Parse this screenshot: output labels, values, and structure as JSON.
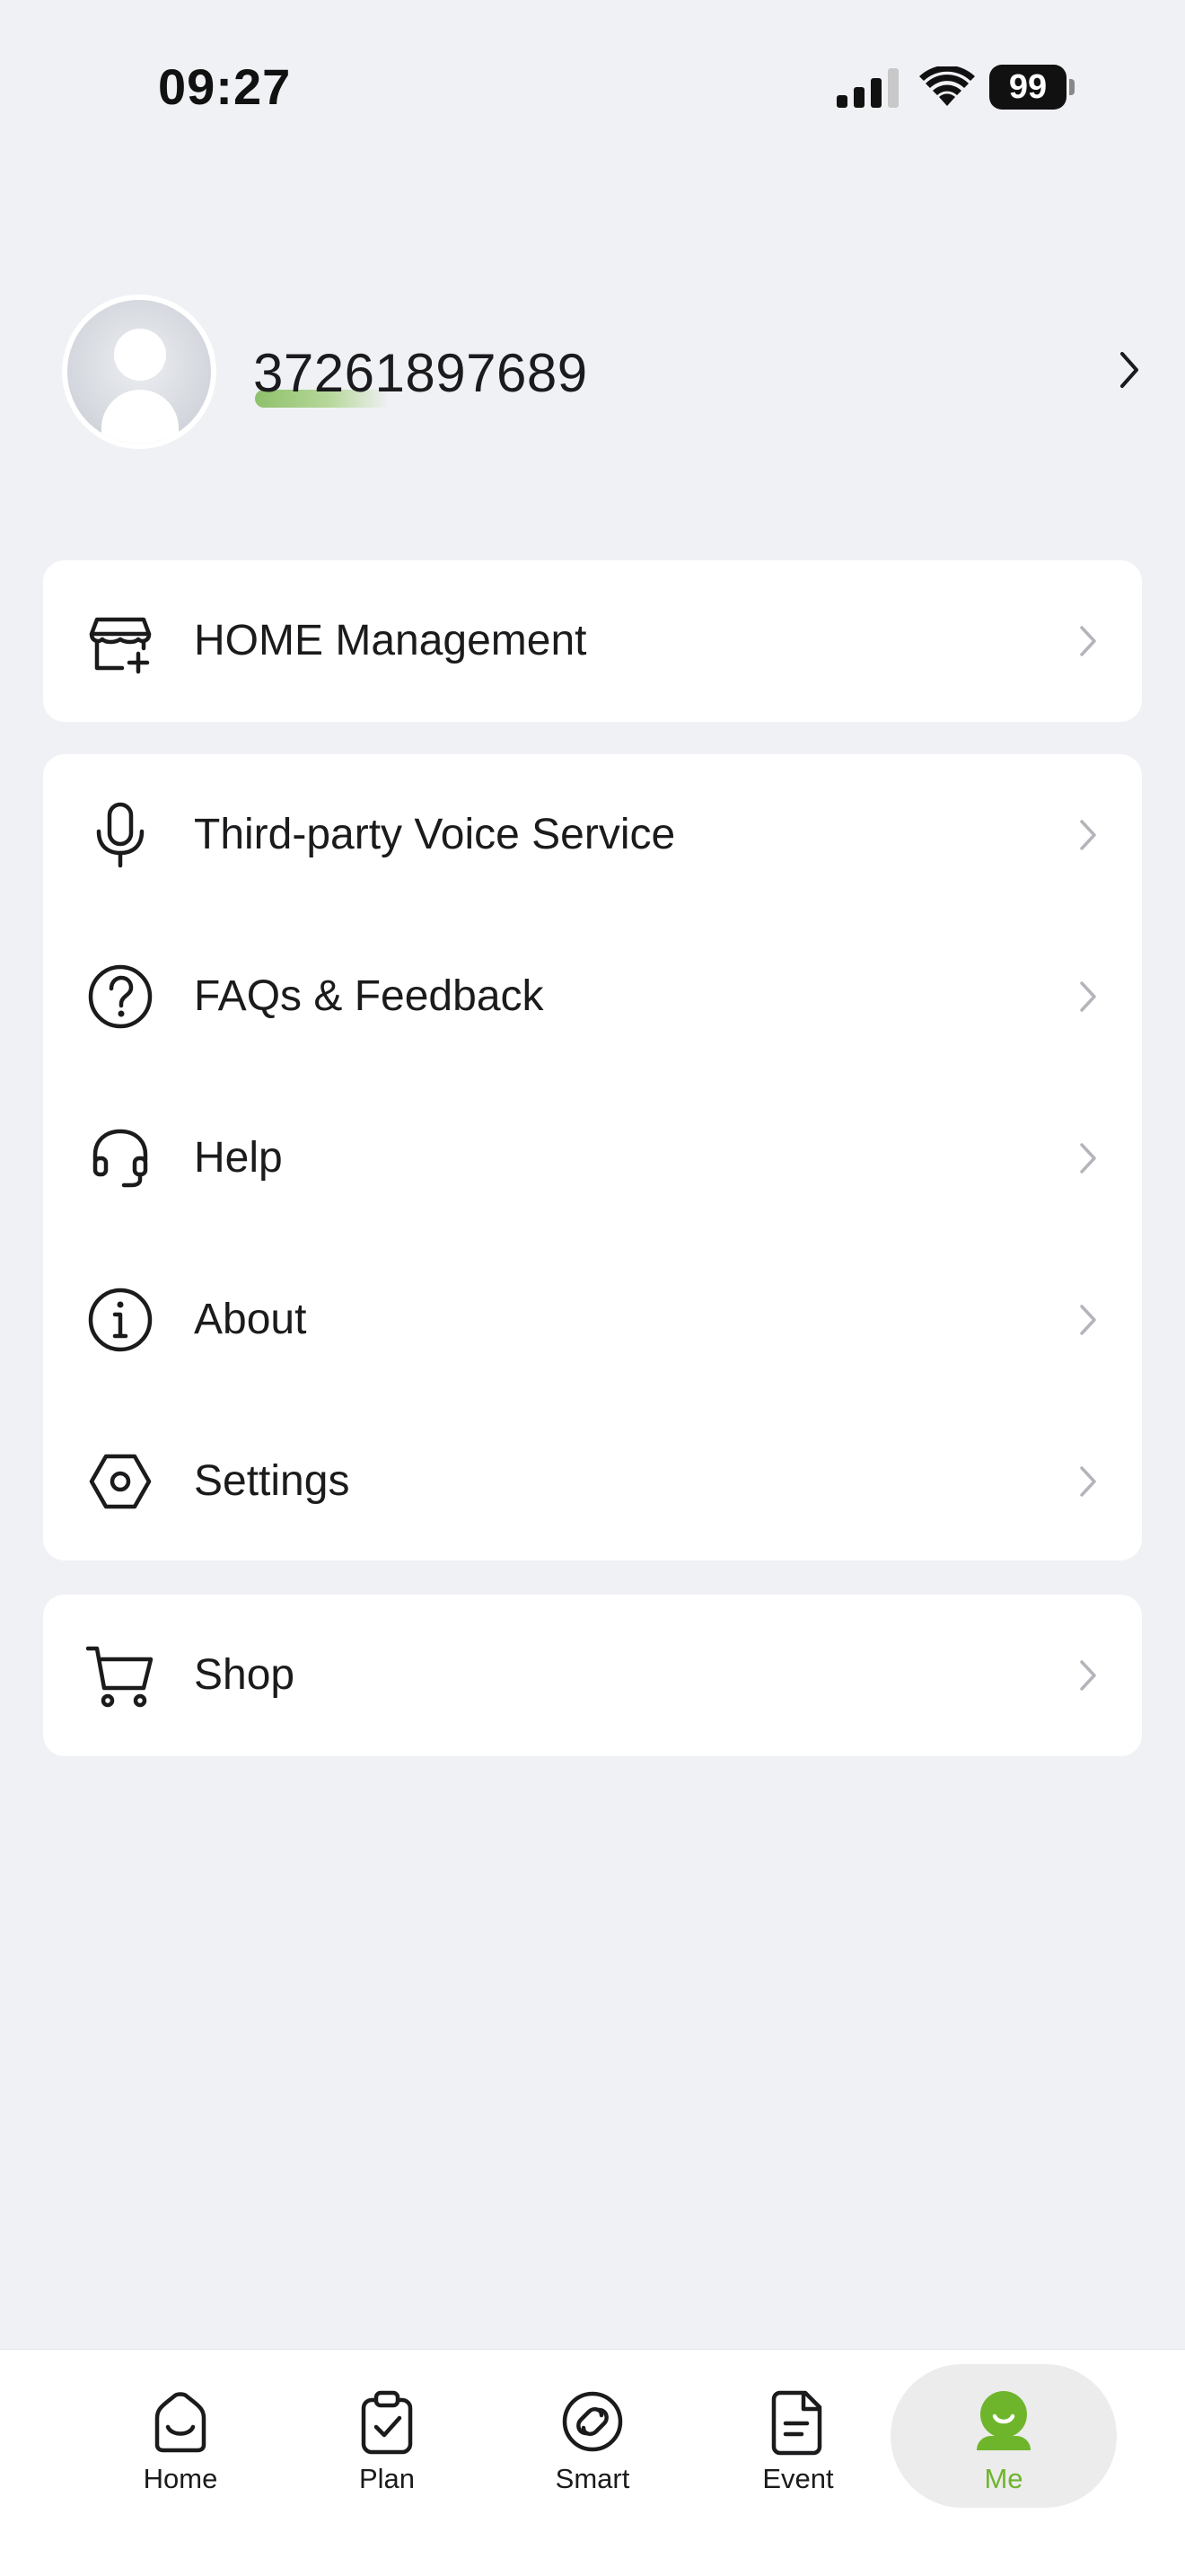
{
  "status_bar": {
    "time": "09:27",
    "battery": "99"
  },
  "profile": {
    "user_id": "37261897689"
  },
  "menu": {
    "home_management": "HOME Management",
    "voice_service": "Third-party Voice Service",
    "faqs": "FAQs  & Feedback",
    "help": "Help",
    "about": "About",
    "settings": "Settings",
    "shop": "Shop"
  },
  "tabs": {
    "home": "Home",
    "plan": "Plan",
    "smart": "Smart",
    "event": "Event",
    "me": "Me"
  },
  "colors": {
    "accent": "#6fb52c",
    "background": "#f0f1f5",
    "card": "#ffffff",
    "chevron": "#b3b5ba"
  }
}
